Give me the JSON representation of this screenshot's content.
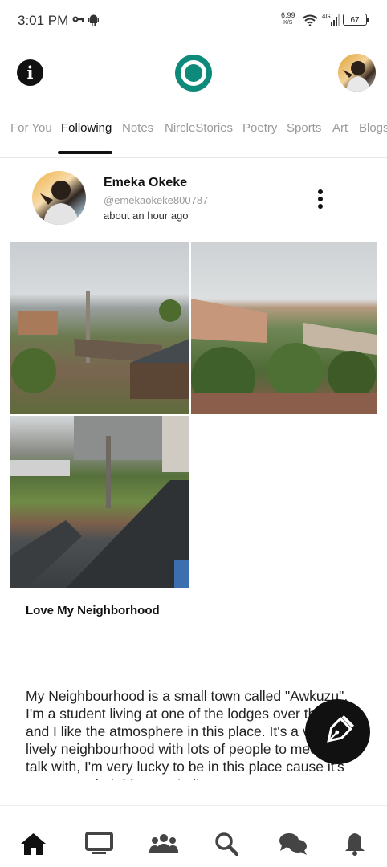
{
  "status_bar": {
    "time": "3:01 PM",
    "net_speed_value": "6.99",
    "net_speed_unit": "K/S",
    "network_type": "4G",
    "battery": "67",
    "icons": [
      "key-icon",
      "android-icon",
      "wifi-icon",
      "signal-icon",
      "battery-icon"
    ]
  },
  "header": {
    "info_icon": "info-icon",
    "logo_icon": "app-logo",
    "avatar_icon": "profile-avatar"
  },
  "tabs": [
    {
      "label": "For You",
      "active": false
    },
    {
      "label": "Following",
      "active": true
    },
    {
      "label": "Notes",
      "active": false
    },
    {
      "label": "NircleStories",
      "active": false
    },
    {
      "label": "Poetry",
      "active": false
    },
    {
      "label": "Sports",
      "active": false
    },
    {
      "label": "Art",
      "active": false
    },
    {
      "label": "Blogs",
      "active": false
    }
  ],
  "post": {
    "author_name": "Emeka Okeke",
    "author_handle": "@emekaokeke800787",
    "time_ago": "about an hour ago",
    "title": "Love My Neighborhood",
    "body": "My Neighbourhood is a small town called \"Awkuzu\", I'm a student living at one of the lodges over there and I like the atmosphere in this place. It's a very lively neighbourhood with lots of people to meet and talk with, I'm very lucky to be in this place cause it's a very comfortable area to live.",
    "photos": [
      "neighborhood-photo-1",
      "neighborhood-photo-2",
      "neighborhood-photo-3"
    ]
  },
  "compose": {
    "icon": "pen-nib-icon"
  },
  "bottom_nav": [
    "home-icon",
    "tv-icon",
    "people-icon",
    "search-icon",
    "chat-icon",
    "bell-icon"
  ],
  "colors": {
    "accent": "#0e8a7a",
    "text": "#111111",
    "muted": "#9a9a9a"
  }
}
